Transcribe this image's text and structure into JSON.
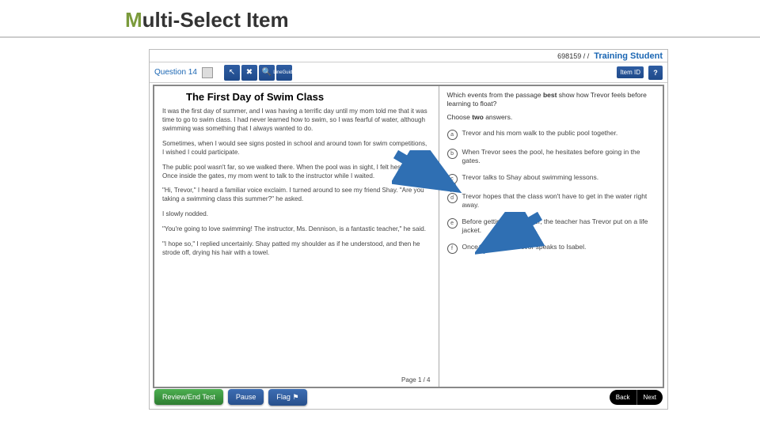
{
  "slide": {
    "title_part1": "M",
    "title_part2": "ulti-Select Item"
  },
  "header": {
    "student_id": "698159 / /",
    "role": "Training Student"
  },
  "toolbar": {
    "question_label": "Question 14",
    "pointer_icon": "↖",
    "strike_icon": "✖",
    "magnify_icon": "🔍",
    "lineguide_label_1": "Line",
    "lineguide_label_2": "Guide",
    "item_id_label": "Item ID",
    "help_label": "?"
  },
  "passage": {
    "title": "The First Day of Swim Class",
    "paragraphs": [
      "It was the first day of summer, and I was having a terrific day until my mom told me that it was time to go to swim class. I had never learned how to swim, so I was fearful of water, although swimming was something that I always wanted to do.",
      "Sometimes, when I would see signs posted in school and around town for swim competitions, I wished I could participate.",
      "The public pool wasn't far, so we walked there. When the pool was in sight, I felt hesitant. Once inside the gates, my mom went to talk to the instructor while I waited.",
      "\"Hi, Trevor,\" I heard a familiar voice exclaim. I turned around to see my friend Shay. \"Are you taking a swimming class this summer?\" he asked.",
      "I slowly nodded.",
      "\"You're going to love swimming! The instructor, Ms. Dennison, is a fantastic teacher,\" he said.",
      "\"I hope so,\" I replied uncertainly. Shay patted my shoulder as if he understood, and then he strode off, drying his hair with a towel."
    ],
    "page_indicator": "Page 1 / 4"
  },
  "question": {
    "stem_pre": "Which events from the passage ",
    "stem_bold": "best",
    "stem_post": " show how Trevor feels before learning to float?",
    "instruction_pre": "Choose ",
    "instruction_bold": "two",
    "instruction_post": " answers.",
    "options": [
      {
        "letter": "a",
        "text": "Trevor and his mom walk to the public pool together."
      },
      {
        "letter": "b",
        "text": "When Trevor sees the pool, he hesitates before going in the gates."
      },
      {
        "letter": "c",
        "text": "Trevor talks to Shay about swimming lessons."
      },
      {
        "letter": "d",
        "text": "Trevor hopes that the class won't have to get in the water right away."
      },
      {
        "letter": "e",
        "text": "Before getting in the water, the teacher has Trevor put on a life jacket."
      },
      {
        "letter": "f",
        "text": "Once in the pool, Trevor speaks to Isabel."
      }
    ]
  },
  "footer": {
    "review_label": "Review/End Test",
    "pause_label": "Pause",
    "flag_label": "Flag",
    "back_label": "Back",
    "next_label": "Next"
  },
  "colors": {
    "accent_green": "#7a9a3b",
    "brand_blue": "#1a66b3"
  }
}
